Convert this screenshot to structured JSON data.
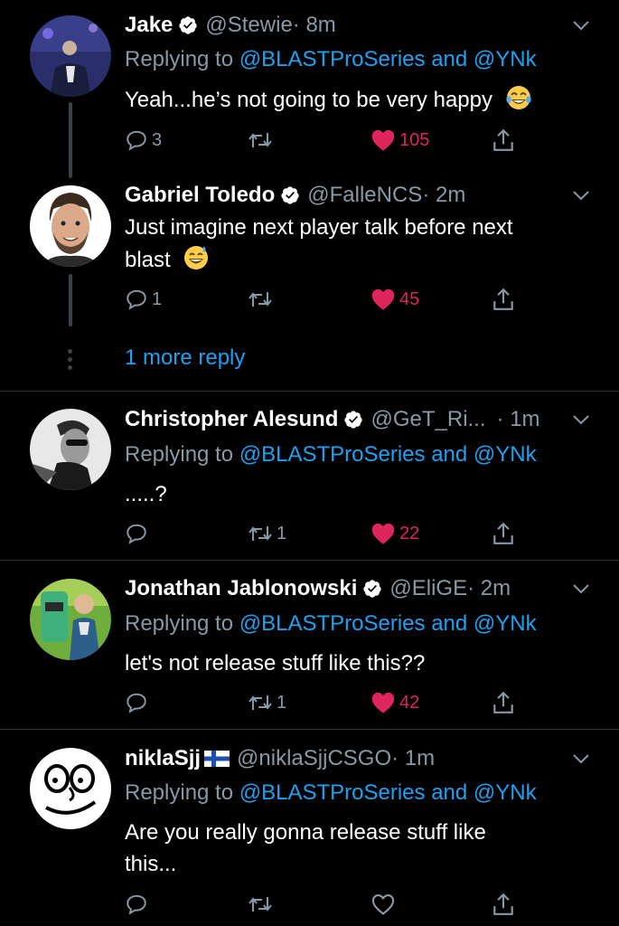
{
  "colors": {
    "background": "#000000",
    "text_primary": "#ffffff",
    "text_secondary": "#8899a6",
    "link": "#1da1f2",
    "like": "#e0245e",
    "divider": "#2f3336",
    "verified": "#ffffff"
  },
  "tweets": [
    {
      "name": "Jake",
      "handle": "@Stewie",
      "time": "· 8m",
      "replying_prefix": "Replying to ",
      "replying_mentions": "@BLASTProSeries and @YNk",
      "text": "Yeah...he’s not going to be very happy",
      "emoji": "face-with-tears-of-joy",
      "reply_count": "3",
      "retweet_count": "",
      "like_count": "105",
      "liked": true
    },
    {
      "name": "Gabriel Toledo",
      "handle": "@FalleNCS",
      "time": "· 2m",
      "text_line1": "Just imagine next player talk before next",
      "text_line2": "blast",
      "emoji": "grinning-face-with-sweat",
      "reply_count": "1",
      "retweet_count": "",
      "like_count": "45",
      "liked": true
    },
    {
      "more_replies": "1 more reply"
    },
    {
      "name": "Christopher Alesund",
      "handle": "@GeT_Ri...",
      "time": "· 1m",
      "replying_prefix": "Replying to ",
      "replying_mentions": "@BLASTProSeries and @YNk",
      "text": ".....?",
      "reply_count": "",
      "retweet_count": "1",
      "like_count": "22",
      "liked": true
    },
    {
      "name": "Jonathan Jablonowski",
      "handle": "@EliGE",
      "time": "· 2m",
      "replying_prefix": "Replying to ",
      "replying_mentions": "@BLASTProSeries and @YNk",
      "text": "let's not release stuff like this??",
      "reply_count": "",
      "retweet_count": "1",
      "like_count": "42",
      "liked": true
    },
    {
      "name": "niklaSjj",
      "flag": "finland-flag",
      "handle": "@niklaSjjCSGO",
      "time": "· 1m",
      "replying_prefix": "Replying to ",
      "replying_mentions": "@BLASTProSeries and @YNk",
      "text_line1": "Are you really gonna release stuff like",
      "text_line2": "this...",
      "reply_count": "",
      "retweet_count": "",
      "like_count": "",
      "liked": false
    }
  ]
}
